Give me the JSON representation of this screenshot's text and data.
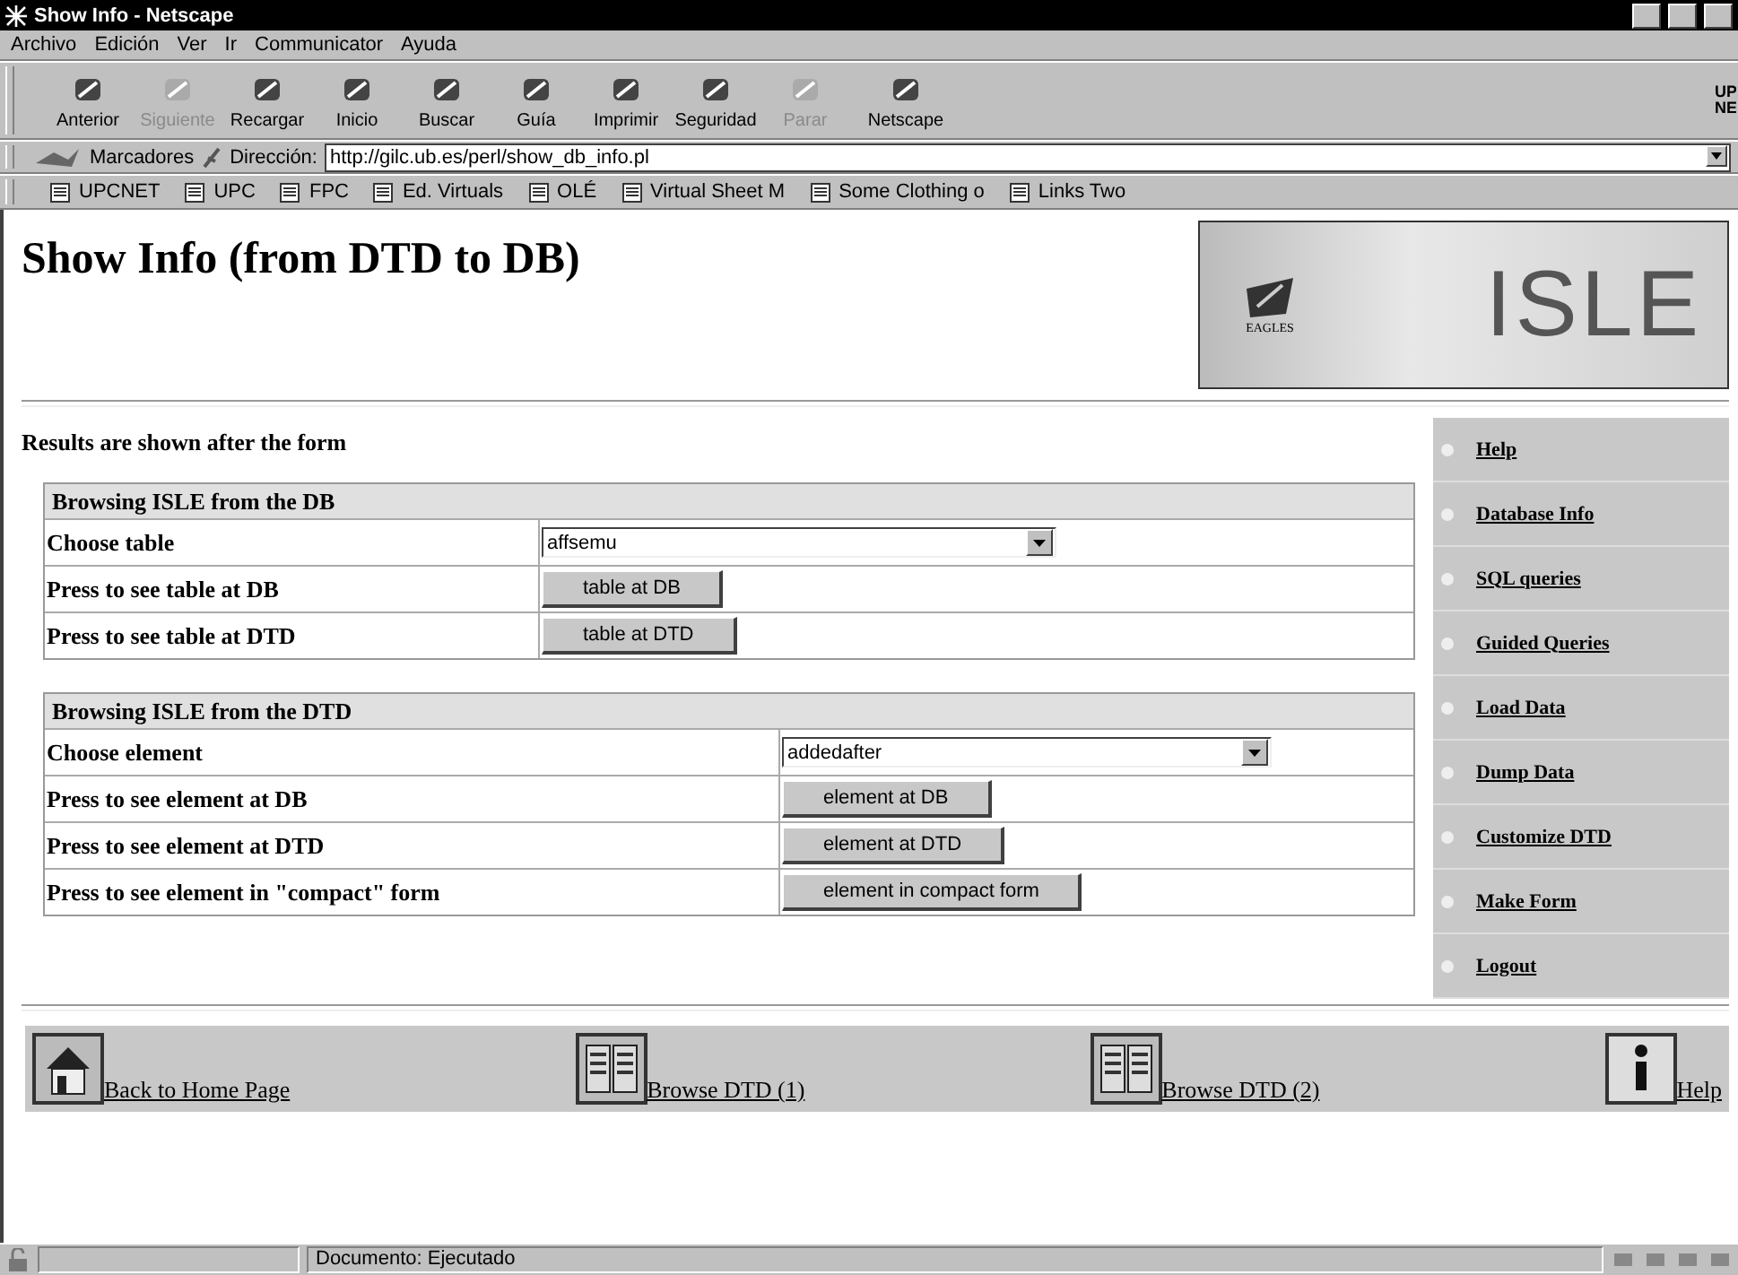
{
  "window": {
    "title": "Show Info - Netscape"
  },
  "menu": [
    "Archivo",
    "Edición",
    "Ver",
    "Ir",
    "Communicator",
    "Ayuda"
  ],
  "toolbar": [
    {
      "label": "Anterior",
      "disabled": false
    },
    {
      "label": "Siguiente",
      "disabled": true
    },
    {
      "label": "Recargar",
      "disabled": false
    },
    {
      "label": "Inicio",
      "disabled": false
    },
    {
      "label": "Buscar",
      "disabled": false
    },
    {
      "label": "Guía",
      "disabled": false
    },
    {
      "label": "Imprimir",
      "disabled": false
    },
    {
      "label": "Seguridad",
      "disabled": false
    },
    {
      "label": "Parar",
      "disabled": true
    },
    {
      "label": "Netscape",
      "disabled": false
    }
  ],
  "corner_logo": [
    "UP",
    "NE"
  ],
  "location_bar": {
    "bookmarks": "Marcadores",
    "address_label": "Dirección:",
    "url": "http://gilc.ub.es/perl/show_db_info.pl"
  },
  "personal_bar": [
    "UPCNET",
    "UPC",
    "FPC",
    "Ed. Virtuals",
    "OLÉ",
    "Virtual Sheet M",
    "Some Clothing o",
    "Links Two"
  ],
  "page": {
    "heading": "Show Info (from DTD to DB)",
    "logo": {
      "badge": "EAGLES",
      "name": "ISLE"
    },
    "intro": "Results are shown after the form",
    "sections": [
      {
        "title": "Browsing ISLE from the DB",
        "rows": [
          {
            "kind": "select",
            "label": "Choose table",
            "value": "affsemu"
          },
          {
            "kind": "button",
            "label": "Press to see table at DB",
            "button": "table at DB"
          },
          {
            "kind": "button",
            "label": "Press to see table at DTD",
            "button": "table at DTD"
          }
        ]
      },
      {
        "title": "Browsing ISLE from the DTD",
        "rows": [
          {
            "kind": "select",
            "label": "Choose element",
            "value": "addedafter"
          },
          {
            "kind": "button",
            "label": "Press to see element at DB",
            "button": "element at DB"
          },
          {
            "kind": "button",
            "label": "Press to see element at DTD",
            "button": "element at DTD"
          },
          {
            "kind": "button",
            "label": "Press to see element in \"compact\" form",
            "button": "element in compact form"
          }
        ]
      }
    ],
    "sidebar": [
      "Help",
      "Database Info",
      "SQL queries",
      "Guided Queries",
      "Load Data",
      "Dump Data",
      "Customize DTD",
      "Make Form",
      "Logout"
    ],
    "footer": [
      {
        "kind": "home",
        "label": "Back to Home Page"
      },
      {
        "kind": "book",
        "label": "Browse DTD (1)"
      },
      {
        "kind": "book",
        "label": "Browse DTD (2)"
      },
      {
        "kind": "info",
        "label": "Help"
      }
    ]
  },
  "status_bar": {
    "text": "Documento: Ejecutado"
  }
}
